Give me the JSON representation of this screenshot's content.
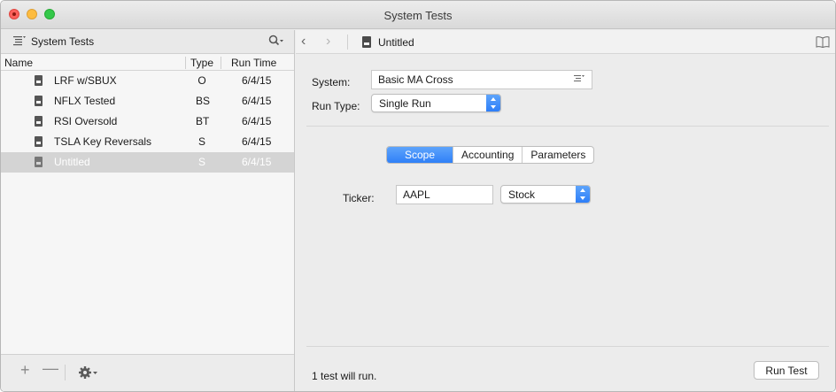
{
  "window": {
    "title": "System Tests"
  },
  "sidebar": {
    "title": "System Tests",
    "columns": {
      "name": "Name",
      "type": "Type",
      "run_time": "Run Time"
    },
    "rows": [
      {
        "name": "LRF w/SBUX",
        "type": "O",
        "run_time": "6/4/15"
      },
      {
        "name": "NFLX Tested",
        "type": "BS",
        "run_time": "6/4/15"
      },
      {
        "name": "RSI Oversold",
        "type": "BT",
        "run_time": "6/4/15"
      },
      {
        "name": "TSLA Key Reversals",
        "type": "S",
        "run_time": "6/4/15"
      },
      {
        "name": "Untitled",
        "type": "S",
        "run_time": "6/4/15"
      }
    ],
    "footer": {
      "add": "+",
      "remove": "—"
    }
  },
  "main": {
    "header_title": "Untitled",
    "system_label": "System:",
    "system_value": "Basic MA Cross",
    "run_type_label": "Run Type:",
    "run_type_value": "Single Run",
    "tabs": [
      "Scope",
      "Accounting",
      "Parameters"
    ],
    "ticker_label": "Ticker:",
    "ticker_value": "AAPL",
    "security_type": "Stock",
    "status": "1 test will run.",
    "run_button": "Run Test"
  },
  "colors": {
    "accent": "#2f80f8",
    "selection": "#d4d4d4"
  }
}
